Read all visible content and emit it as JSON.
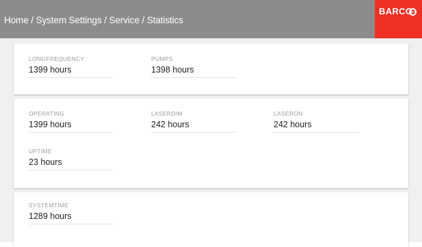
{
  "header": {
    "breadcrumb": "Home / System Settings / Service / Statistics",
    "brand": "BARCO",
    "background_color": "#8c8c8c",
    "brand_color": "#ee3124"
  },
  "stats": {
    "longfrequency": {
      "label": "LONGFREQUENCY",
      "value": "1399 hours"
    },
    "pumps": {
      "label": "PUMPS",
      "value": "1398 hours"
    },
    "operating": {
      "label": "OPERATING",
      "value": "1399 hours"
    },
    "laserdim": {
      "label": "LASERDIM",
      "value": "242 hours"
    },
    "laseron": {
      "label": "LASERON",
      "value": "242 hours"
    },
    "uptime": {
      "label": "UPTIME",
      "value": "23 hours"
    },
    "systemtime": {
      "label": "SYSTEMTIME",
      "value": "1289 hours"
    }
  }
}
